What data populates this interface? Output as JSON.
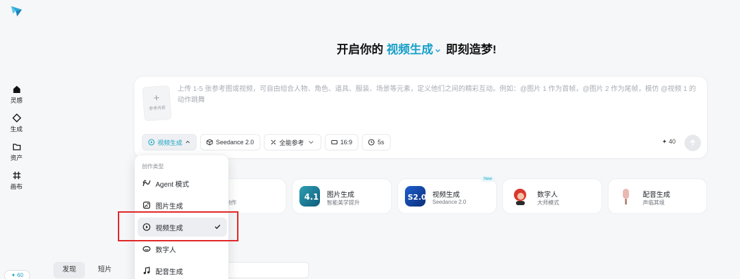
{
  "sidebar": {
    "items": [
      {
        "label": "灵感",
        "icon": "home-icon"
      },
      {
        "label": "生成",
        "icon": "diamond-icon"
      },
      {
        "label": "资产",
        "icon": "folder-icon"
      },
      {
        "label": "画布",
        "icon": "canvas-icon"
      }
    ],
    "credits": "✦ 60"
  },
  "headline": {
    "prefix": "开启你的",
    "mode": "视频生成",
    "suffix": "即刻造梦!"
  },
  "composer": {
    "ref_tile_label": "参考内容",
    "placeholder": "上传 1-5 张参考图或视频，可自由组合人物、角色、道具、服装、场景等元素，定义他们之间的精彩互动。例如：@图片 1 作为首帧，@图片 2 作为尾帧，模仿 @视频 1 的动作跳舞",
    "toolbar": {
      "mode": "视频生成",
      "model": "Seedance 2.0",
      "reference": "全能参考",
      "ratio": "16:9",
      "duration": "5s"
    },
    "cost": "✦ 40"
  },
  "feature_cards": [
    {
      "title": "",
      "subtitle": "创作"
    },
    {
      "title": "图片生成",
      "subtitle": "智能美学提升"
    },
    {
      "title": "视频生成",
      "subtitle": "Seedance 2.0",
      "tag": "New"
    },
    {
      "title": "数字人",
      "subtitle": "大师模式"
    },
    {
      "title": "配音生成",
      "subtitle": "声临其境"
    }
  ],
  "tabs": [
    {
      "label": "发现"
    },
    {
      "label": "短片"
    }
  ],
  "dropdown": {
    "header": "创作类型",
    "items": [
      {
        "label": "Agent 模式",
        "icon": "agent-icon"
      },
      {
        "label": "图片生成",
        "icon": "image-icon"
      },
      {
        "label": "视频生成",
        "icon": "video-icon",
        "selected": true
      },
      {
        "label": "数字人",
        "icon": "avatar-icon"
      },
      {
        "label": "配音生成",
        "icon": "music-note-icon"
      }
    ]
  },
  "colors": {
    "accent": "#18a0c9",
    "highlight": "#e02424"
  }
}
